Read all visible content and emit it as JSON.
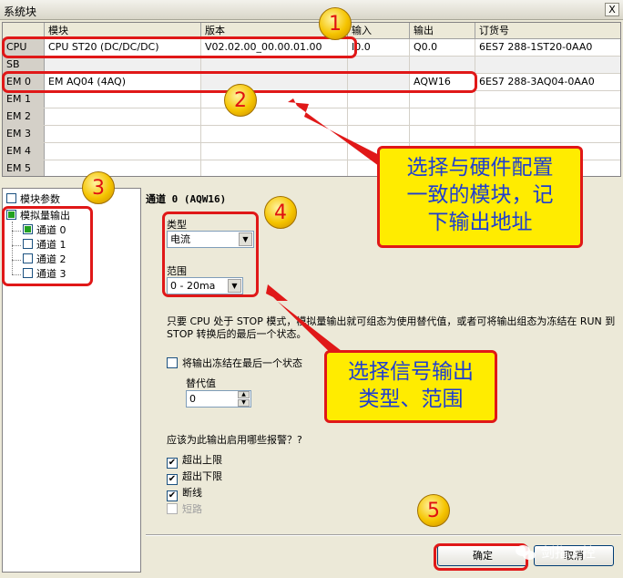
{
  "window": {
    "title": "系统块",
    "close": "X"
  },
  "table": {
    "headers": [
      "",
      "模块",
      "版本",
      "输入",
      "输出",
      "订货号"
    ],
    "rows": [
      {
        "slot": "CPU",
        "module": "CPU ST20 (DC/DC/DC)",
        "version": "V02.02.00_00.00.01.00",
        "input": "I0.0",
        "output": "Q0.0",
        "order": "6ES7 288-1ST20-0AA0"
      },
      {
        "slot": "SB",
        "module": "",
        "version": "",
        "input": "",
        "output": "",
        "order": ""
      },
      {
        "slot": "EM 0",
        "module": "EM AQ04 (4AQ)",
        "version": "",
        "input": "",
        "output": "AQW16",
        "order": "6ES7 288-3AQ04-0AA0"
      },
      {
        "slot": "EM 1",
        "module": "",
        "version": "",
        "input": "",
        "output": "",
        "order": ""
      },
      {
        "slot": "EM 2",
        "module": "",
        "version": "",
        "input": "",
        "output": "",
        "order": ""
      },
      {
        "slot": "EM 3",
        "module": "",
        "version": "",
        "input": "",
        "output": "",
        "order": ""
      },
      {
        "slot": "EM 4",
        "module": "",
        "version": "",
        "input": "",
        "output": "",
        "order": ""
      },
      {
        "slot": "EM 5",
        "module": "",
        "version": "",
        "input": "",
        "output": "",
        "order": ""
      }
    ]
  },
  "tree": {
    "module_params": "模块参数",
    "analog_output": "模拟量输出",
    "channels": [
      "通道 0",
      "通道 1",
      "通道 2",
      "通道 3"
    ]
  },
  "panel": {
    "title": "通道 0 (AQW16)",
    "type_label": "类型",
    "type_value": "电流",
    "range_label": "范围",
    "range_value": "0 - 20ma",
    "stop_note": "只要 CPU 处于 STOP 模式，模拟量输出就可组态为使用替代值，或者可将输出组态为冻结在 RUN 到 STOP 转换后的最后一个状态。",
    "freeze_label": "将输出冻结在最后一个状态",
    "sub_label": "替代值",
    "sub_value": "0",
    "alarm_question": "应该为此输出启用哪些报警？?",
    "alarms": [
      {
        "label": "超出上限",
        "checked": true,
        "enabled": true
      },
      {
        "label": "超出下限",
        "checked": true,
        "enabled": true
      },
      {
        "label": "断线",
        "checked": true,
        "enabled": true
      },
      {
        "label": "短路",
        "checked": false,
        "enabled": false
      }
    ],
    "ok": "确定",
    "cancel": "取消"
  },
  "annotations": {
    "badges": [
      "1",
      "2",
      "3",
      "4",
      "5"
    ],
    "callout1": [
      "选择与硬件配置",
      "一致的模块，记",
      "下输出地址"
    ],
    "callout2": [
      "选择信号输出",
      "类型、范围"
    ],
    "accent": "#e01818",
    "callout_fill": "#ffec00",
    "callout_text": "#1f3fd0"
  },
  "watermark": "剑指工控"
}
